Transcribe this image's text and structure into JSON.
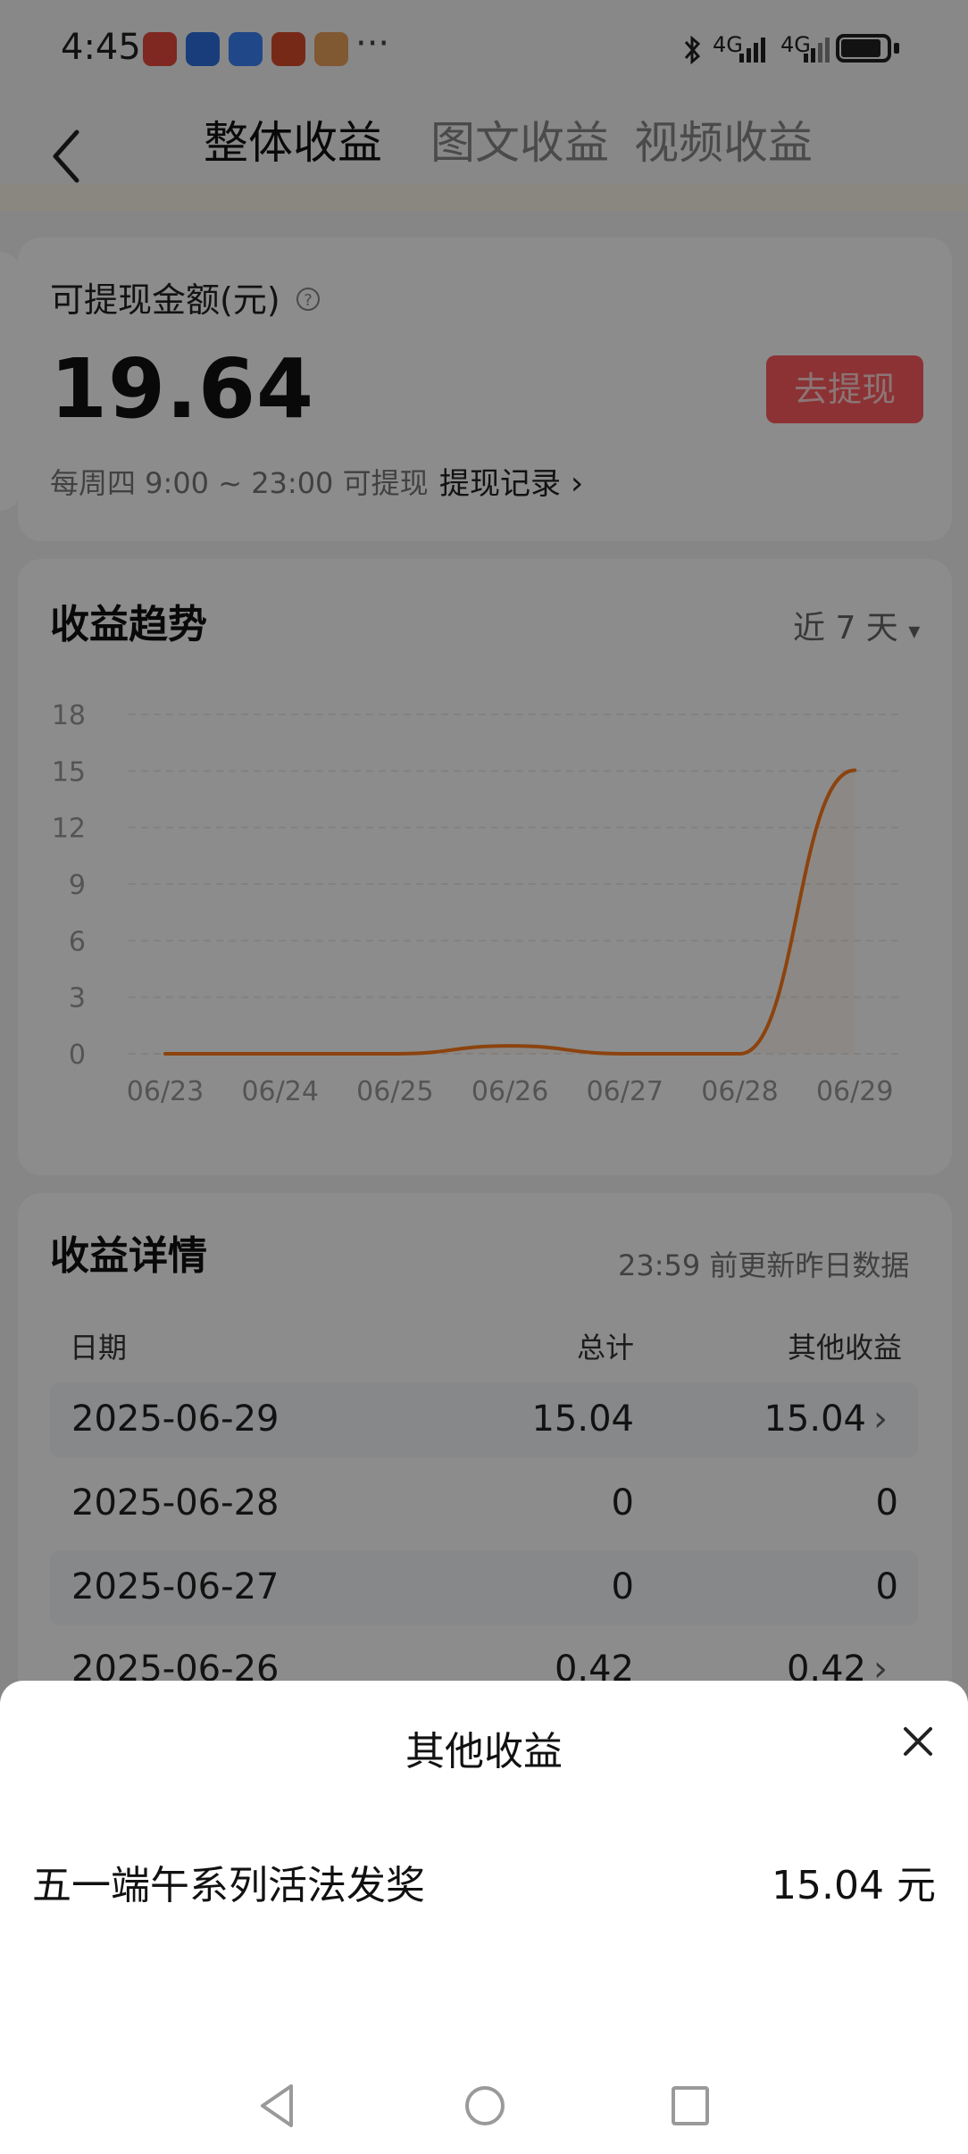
{
  "status_bar": {
    "time": "4:45",
    "more": "···",
    "network1": "4G",
    "network2": "4G"
  },
  "tabs": [
    {
      "label": "整体收益",
      "active": true
    },
    {
      "label": "图文收益",
      "active": false
    },
    {
      "label": "视频收益",
      "active": false
    }
  ],
  "withdraw_card": {
    "label": "可提现金额(元)",
    "help": "?",
    "amount": "19.64",
    "button": "去提现",
    "schedule": "每周四 9:00 ~ 23:00 可提现",
    "records_link": "提现记录",
    "chevron": "›"
  },
  "trend": {
    "title": "收益趋势",
    "range": "近 7 天",
    "range_caret": "▾"
  },
  "chart_data": {
    "type": "line",
    "x": [
      "06/23",
      "06/24",
      "06/25",
      "06/26",
      "06/27",
      "06/28",
      "06/29"
    ],
    "series": [
      {
        "values": [
          0,
          0,
          0,
          0.42,
          0,
          0,
          15.04
        ]
      }
    ],
    "yticks": [
      "0",
      "3",
      "6",
      "9",
      "12",
      "15",
      "18"
    ],
    "ylim": [
      0,
      18
    ],
    "grid": true,
    "line_color": "#ff7a1a"
  },
  "details": {
    "title": "收益详情",
    "update_note": "23:59 前更新昨日数据",
    "headers": [
      "日期",
      "总计",
      "其他收益"
    ],
    "rows": [
      {
        "date": "2025-06-29",
        "total": "15.04",
        "other": "15.04",
        "chevron": "›"
      },
      {
        "date": "2025-06-28",
        "total": "0",
        "other": "0",
        "chevron": ""
      },
      {
        "date": "2025-06-27",
        "total": "0",
        "other": "0",
        "chevron": ""
      },
      {
        "date": "2025-06-26",
        "total": "0.42",
        "other": "0.42",
        "chevron": "›"
      }
    ]
  },
  "sheet": {
    "title": "其他收益",
    "item_name": "五一端午系列活法发奖",
    "item_amount": "15.04 元"
  },
  "colors": {
    "accent": "#ff5b60",
    "line": "#ff7a1a"
  }
}
